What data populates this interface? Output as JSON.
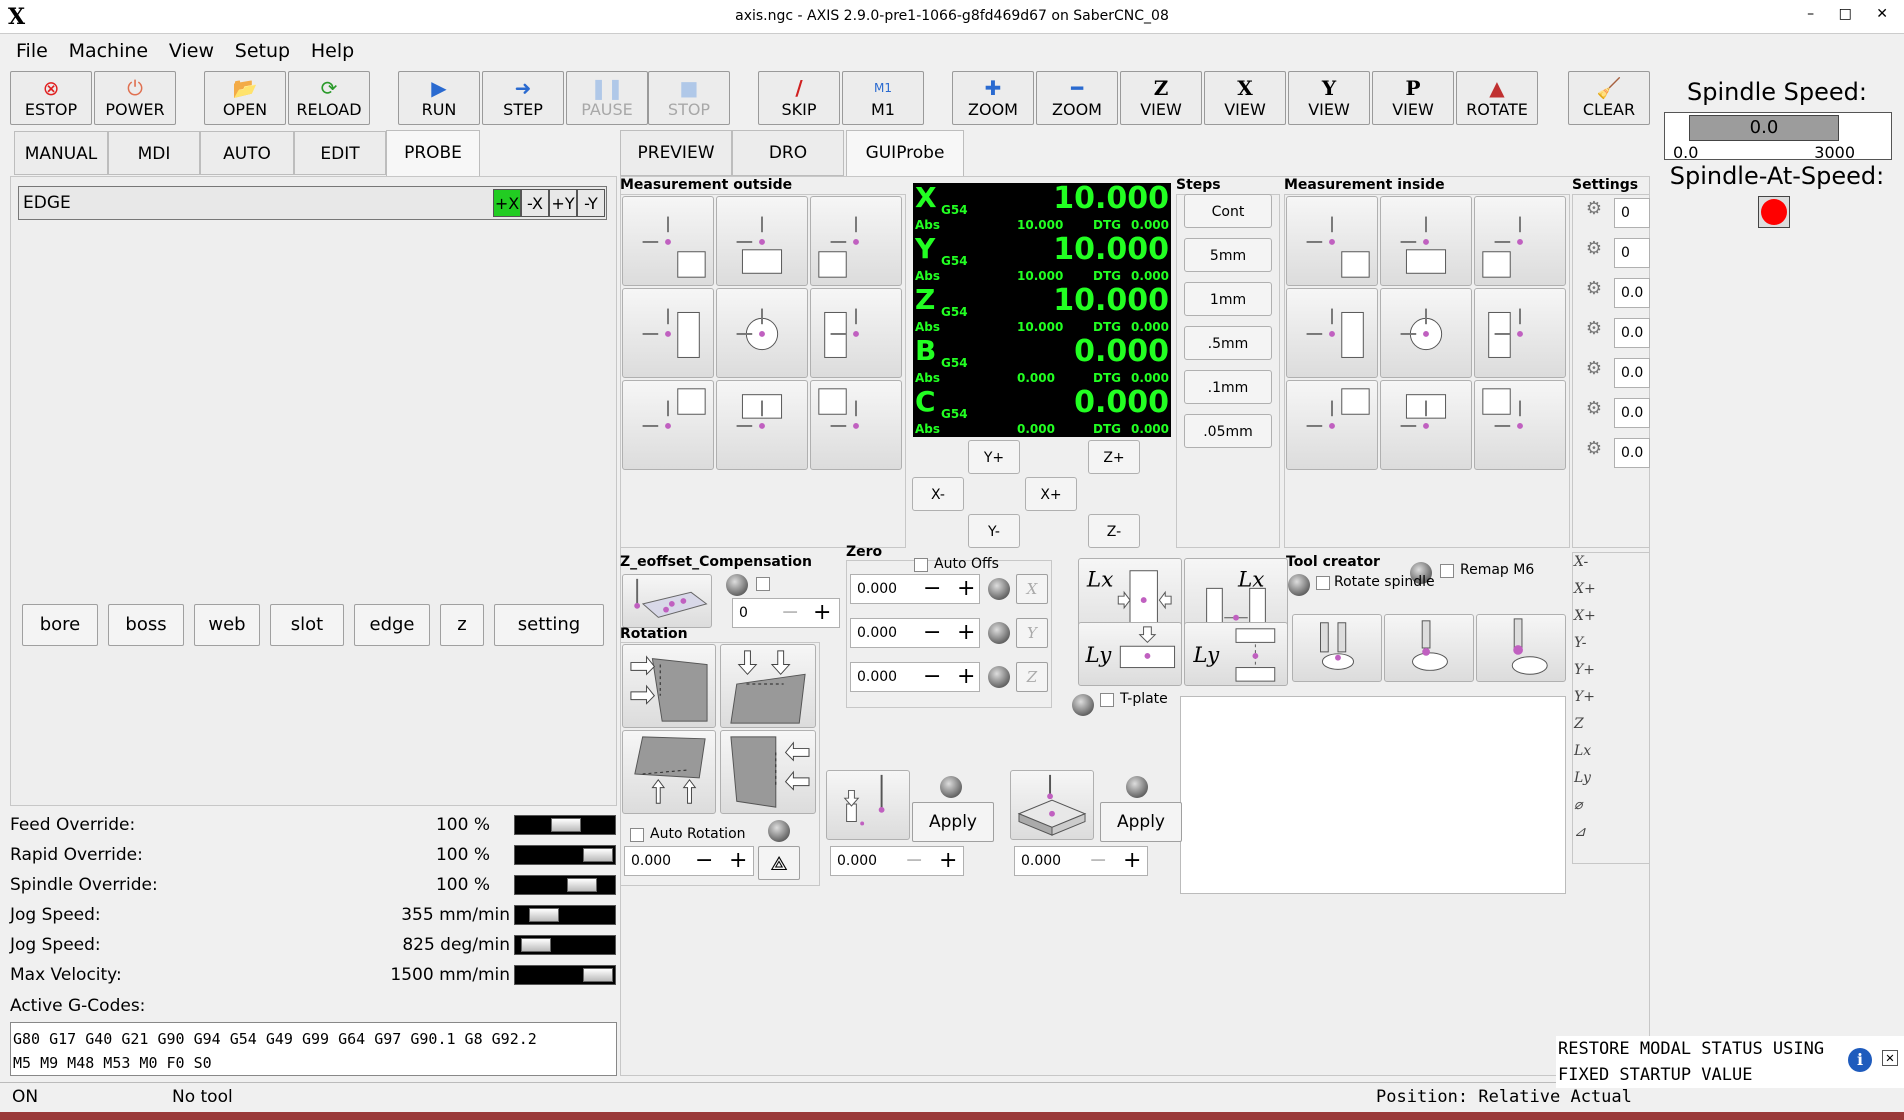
{
  "window": {
    "title": "axis.ngc - AXIS 2.9.0-pre1-1066-g8fd469d67 on SaberCNC_08",
    "logo": "X",
    "controls": "– □ ✕"
  },
  "menu": [
    "File",
    "Machine",
    "View",
    "Setup",
    "Help"
  ],
  "toolbar": [
    {
      "id": "estop",
      "label": "ESTOP",
      "icon": "⊗",
      "color": "#e02020"
    },
    {
      "id": "power",
      "label": "POWER",
      "icon": "⏻",
      "color": "#e07050"
    },
    {
      "id": "open",
      "label": "OPEN",
      "icon": "📂"
    },
    {
      "id": "reload",
      "label": "RELOAD",
      "icon": "⟳"
    },
    {
      "id": "run",
      "label": "RUN",
      "icon": "▶"
    },
    {
      "id": "step",
      "label": "STEP",
      "icon": "➜"
    },
    {
      "id": "pause",
      "label": "PAUSE",
      "icon": "❚❚"
    },
    {
      "id": "stop",
      "label": "STOP",
      "icon": "■"
    },
    {
      "id": "skip",
      "label": "SKIP",
      "icon": "/"
    },
    {
      "id": "m1",
      "label": "M1",
      "icon": "M1"
    },
    {
      "id": "zoom_in",
      "label": "ZOOM",
      "icon": "✚"
    },
    {
      "id": "zoom_out",
      "label": "ZOOM",
      "icon": "━"
    },
    {
      "id": "view_z",
      "label": "VIEW",
      "icon": "Z"
    },
    {
      "id": "view_x",
      "label": "VIEW",
      "icon": "X"
    },
    {
      "id": "view_y",
      "label": "VIEW",
      "icon": "Y"
    },
    {
      "id": "view_p",
      "label": "VIEW",
      "icon": "P"
    },
    {
      "id": "rotate",
      "label": "ROTATE",
      "icon": "▲"
    },
    {
      "id": "clear",
      "label": "CLEAR",
      "icon": "🧹"
    }
  ],
  "left_tabs": [
    "MANUAL",
    "MDI",
    "AUTO",
    "EDIT",
    "PROBE"
  ],
  "probe_mode": {
    "label": "EDGE",
    "dirs": [
      "+X",
      "-X",
      "+Y",
      "-Y"
    ]
  },
  "probe_buttons": [
    "bore",
    "boss",
    "web",
    "slot",
    "edge",
    "z",
    "setting"
  ],
  "overrides": [
    {
      "label": "Feed Override:",
      "value": "100",
      "unit": "%"
    },
    {
      "label": "Rapid Override:",
      "value": "100",
      "unit": "%"
    },
    {
      "label": "Spindle Override:",
      "value": "100",
      "unit": "%"
    },
    {
      "label": "Jog Speed:",
      "value": "355",
      "unit": "mm/min"
    },
    {
      "label": "Jog Speed:",
      "value": "825",
      "unit": "deg/min"
    },
    {
      "label": "Max Velocity:",
      "value": "1500",
      "unit": "mm/min"
    }
  ],
  "gcodes": {
    "label": "Active G-Codes:",
    "line1": "G80 G17 G40 G21 G90 G94 G54 G49 G99 G64 G97 G90.1 G8 G92.2",
    "line2": "M5 M9 M48 M53 M0 F0 S0"
  },
  "status": {
    "state": "ON",
    "tool": "No tool",
    "position": "Position: Relative Actual"
  },
  "right_tabs": [
    "PREVIEW",
    "DRO",
    "GUIProbe"
  ],
  "groups": {
    "meas_out": "Measurement outside",
    "steps": "Steps",
    "meas_in": "Measurement inside",
    "settings": "Settings",
    "zeoffset": "Z_eoffset_Compensation",
    "zero": "Zero",
    "rotation": "Rotation",
    "toolcreator": "Tool creator"
  },
  "dro": [
    {
      "axis": "X",
      "cs": "G54",
      "value": "10.000",
      "abs": "10.000",
      "dtg": "0.000"
    },
    {
      "axis": "Y",
      "cs": "G54",
      "value": "10.000",
      "abs": "10.000",
      "dtg": "0.000"
    },
    {
      "axis": "Z",
      "cs": "G54",
      "value": "10.000",
      "abs": "10.000",
      "dtg": "0.000"
    },
    {
      "axis": "B",
      "cs": "G54",
      "value": "0.000",
      "abs": "0.000",
      "dtg": "0.000"
    },
    {
      "axis": "C",
      "cs": "G54",
      "value": "0.000",
      "abs": "0.000",
      "dtg": "0.000"
    }
  ],
  "dro_labels": {
    "abs": "Abs",
    "dtg": "DTG"
  },
  "steps": [
    "Cont",
    "5mm",
    "1mm",
    ".5mm",
    ".1mm",
    ".05mm"
  ],
  "jog": {
    "yp": "Y+",
    "zp": "Z+",
    "xm": "X-",
    "xp": "X+",
    "ym": "Y-",
    "zm": "Z-"
  },
  "settings_values": [
    "0",
    "0",
    "0.0",
    "0.0",
    "0.0",
    "0.0",
    "0.0"
  ],
  "zeoffset_value": "0",
  "zero": {
    "auto_offs": "Auto Offs",
    "values": [
      "0.000",
      "0.000",
      "0.000"
    ],
    "axes": [
      "X",
      "Y",
      "Z"
    ]
  },
  "tplate": "T-plate",
  "remap": "Remap M6",
  "rotate_spindle": "Rotate spindle",
  "auto_rotation": {
    "label": "Auto Rotation",
    "value": "0.000"
  },
  "apply1": {
    "label": "Apply",
    "value": "0.000"
  },
  "apply2": {
    "label": "Apply",
    "value": "0.000"
  },
  "side_icons": [
    "X-",
    "X+",
    "X+",
    "Y-",
    "Y+",
    "Y+",
    "Z",
    "Lx",
    "Ly",
    "⌀",
    "⊿"
  ],
  "spindle": {
    "title": "Spindle Speed:",
    "value": "0.0",
    "min": "0.0",
    "max": "3000",
    "at_speed": "Spindle-At-Speed:",
    "led_color": "#ff0000"
  },
  "message": {
    "line1": "RESTORE MODAL STATUS USING",
    "line2": "FIXED STARTUP VALUE"
  },
  "colors": {
    "dro_fg": "#22ff22",
    "active_dir": "#22cc22"
  }
}
